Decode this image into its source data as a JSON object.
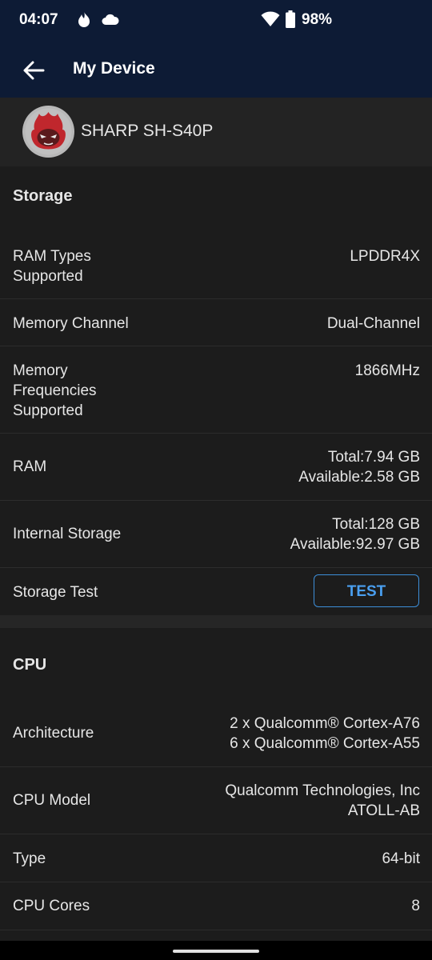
{
  "status_bar": {
    "time": "04:07",
    "battery": "98%"
  },
  "app_bar": {
    "title": "My Device"
  },
  "device": {
    "name": "SHARP SH-S40P"
  },
  "storage": {
    "title": "Storage",
    "ram_types": {
      "label_1": "RAM Types",
      "label_2": "Supported",
      "value": "LPDDR4X"
    },
    "memory_channel": {
      "label": "Memory Channel",
      "value": "Dual-Channel"
    },
    "memory_freq": {
      "label_1": "Memory",
      "label_2": "Frequencies",
      "label_3": "Supported",
      "value": "1866MHz"
    },
    "ram": {
      "label": "RAM",
      "total": "Total:7.94 GB",
      "available": "Available:2.58 GB"
    },
    "internal": {
      "label": "Internal Storage",
      "total": "Total:128 GB",
      "available": "Available:92.97 GB"
    },
    "storage_test": {
      "label": "Storage Test",
      "button": "TEST"
    }
  },
  "cpu": {
    "title": "CPU",
    "architecture": {
      "label": "Architecture",
      "line1": "2 x Qualcomm® Cortex-A76",
      "line2": "6 x Qualcomm® Cortex-A55"
    },
    "model": {
      "label": "CPU Model",
      "line1": "Qualcomm Technologies, Inc",
      "line2": "ATOLL-AB"
    },
    "type": {
      "label": "Type",
      "value": "64-bit"
    },
    "cores": {
      "label": "CPU Cores",
      "value": "8"
    }
  },
  "colors": {
    "accent": "#4a9ff0",
    "header_bg": "#0d1b35",
    "background": "#1c1c1c"
  }
}
